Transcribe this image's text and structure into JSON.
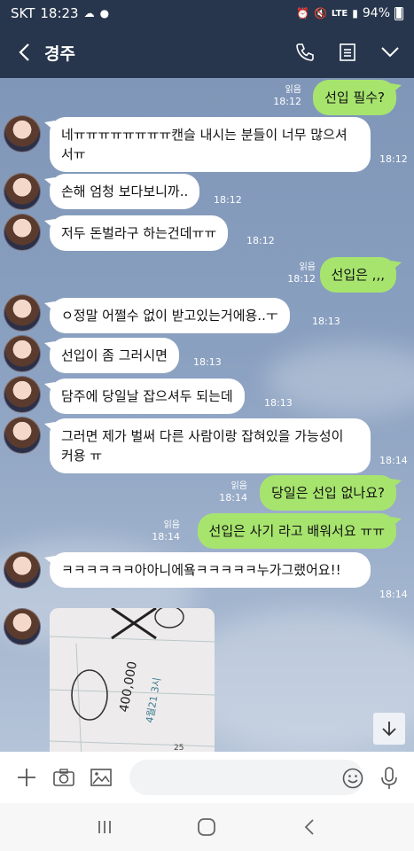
{
  "status_bar": {
    "carrier": "SKT",
    "time": "18:23",
    "network": "LTE",
    "battery": "94%"
  },
  "header": {
    "title": "경주",
    "icons": [
      "back-icon",
      "phone-icon",
      "menu-list-icon",
      "chevron-down-icon"
    ]
  },
  "messages": [
    {
      "side": "out",
      "text": "선입  필수?",
      "read": "읽음",
      "time": "18:12"
    },
    {
      "side": "in",
      "text": "네ㅠㅠㅠㅠㅠㅠㅠㅠ캔슬 내시는 분들이 너무 많으셔서ㅠ",
      "time": "18:12"
    },
    {
      "side": "in",
      "text": "손해 엄청 보다보니까..",
      "time": "18:12"
    },
    {
      "side": "in",
      "text": "저두 돈벌라구 하는건데ㅠㅠ",
      "time": "18:12"
    },
    {
      "side": "out",
      "text": "선입은 ,,,",
      "read": "읽음",
      "time": "18:12"
    },
    {
      "side": "in",
      "text": "ㅇ정말 어쩔수 없이 받고있는거에용..ㅜ",
      "time": "18:13"
    },
    {
      "side": "in",
      "text": "선입이 좀 그러시면",
      "time": "18:13"
    },
    {
      "side": "in",
      "text": "담주에 당일날 잡으셔두 되는데",
      "time": "18:13"
    },
    {
      "side": "in",
      "text": "그러면 제가 벌써 다른 사람이랑 잡혀있을 가능성이 커용 ㅠ",
      "time": "18:14"
    },
    {
      "side": "out",
      "text": "당일은 선입 없나요?",
      "read": "읽음",
      "time": "18:14"
    },
    {
      "side": "out",
      "text": "선입은 사기 라고 배워서요 ㅠㅠ",
      "read": "읽음",
      "time": "18:14"
    },
    {
      "side": "in",
      "text": "ㅋㅋㅋㅋㅋㅋ아아니에욬ㅋㅋㅋㅋㅋ누가그랬어요!!",
      "time": "18:14"
    }
  ],
  "photo": {
    "price": "400,000",
    "notes": "4월21 3시"
  },
  "input": {
    "placeholder": ""
  },
  "colors": {
    "header_bg": "#27364d",
    "outgoing_bubble": "#a7e46e",
    "incoming_bubble": "#ffffff"
  }
}
